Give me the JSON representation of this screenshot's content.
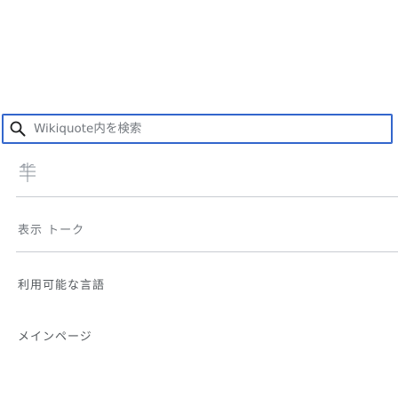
{
  "search": {
    "placeholder": "Wikiquote内を検索",
    "value": ""
  },
  "menu": {
    "items": [
      {
        "label": "表示 トーク"
      },
      {
        "label": "利用可能な言語"
      },
      {
        "label": "メインページ"
      }
    ]
  },
  "colors": {
    "accent": "#3366cc",
    "divider": "#c8ccd1",
    "text_muted": "#72777d"
  },
  "icons": {
    "search": "search-icon",
    "logo": "wikiquote-logo-icon"
  }
}
